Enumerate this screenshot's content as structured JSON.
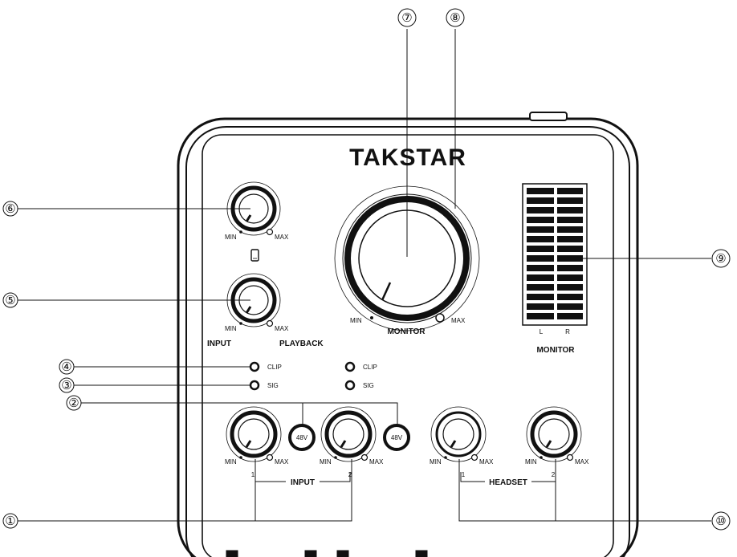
{
  "brand": "TAKSTAR",
  "knob_scale": {
    "min": "MIN",
    "max": "MAX"
  },
  "mix": {
    "input": "INPUT",
    "playback": "PLAYBACK"
  },
  "monitor_knob": {
    "label": "MONITOR"
  },
  "meter": {
    "left": "L",
    "right": "R",
    "label": "MONITOR"
  },
  "leds": {
    "clip": "CLIP",
    "sig": "SIG"
  },
  "phantom": "48V",
  "input_group": {
    "label": "INPUT",
    "ch1": "1",
    "ch2": "2"
  },
  "headset_group": {
    "label": "HEADSET",
    "ch1": "1",
    "ch2": "2"
  },
  "callouts": [
    "①",
    "②",
    "③",
    "④",
    "⑤",
    "⑥",
    "⑦",
    "⑧",
    "⑨",
    "⑩"
  ],
  "colors": {
    "outline": "#111111",
    "background": "#ffffff"
  }
}
